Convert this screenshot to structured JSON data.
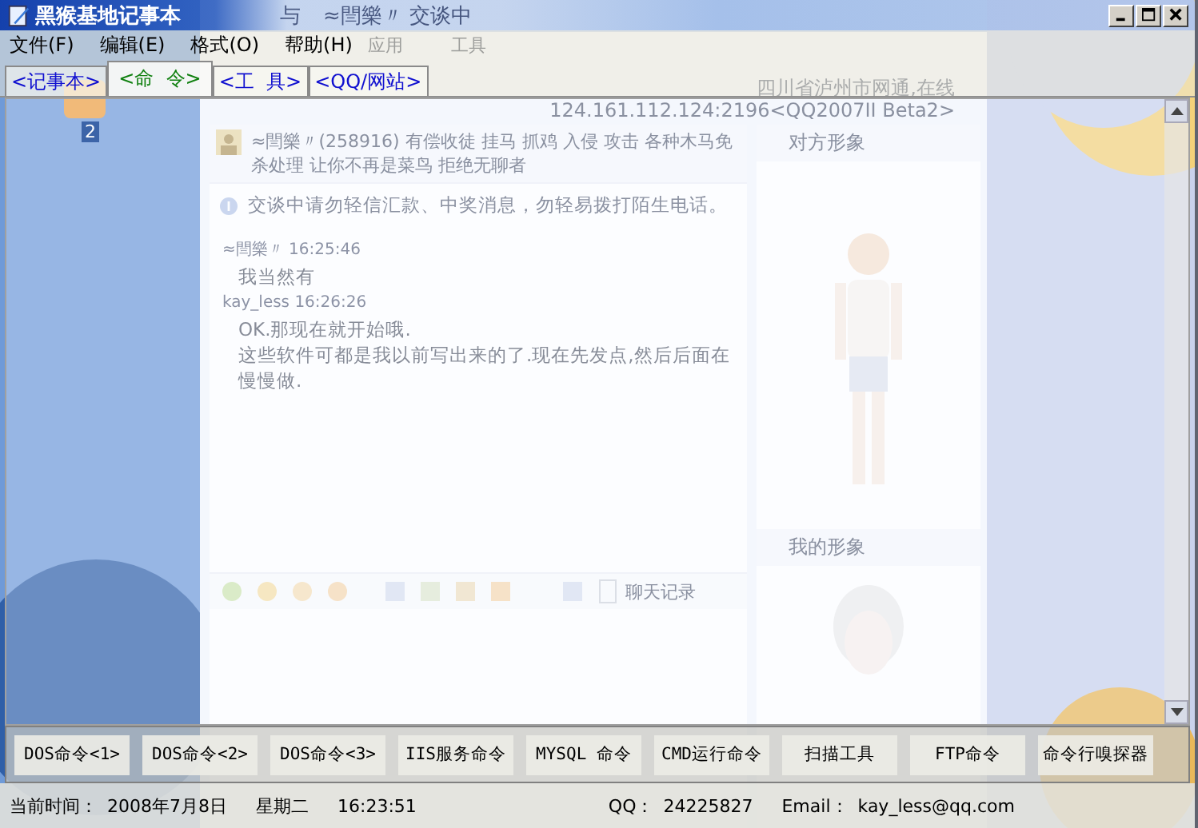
{
  "window": {
    "title": "黑猴基地记事本"
  },
  "menu": [
    {
      "label": "文件(F)"
    },
    {
      "label": "编辑(E)"
    },
    {
      "label": "格式(O)"
    },
    {
      "label": "帮助(H)"
    }
  ],
  "tabs": [
    {
      "label": "<记事本>",
      "selected": false
    },
    {
      "label": "<命  令>",
      "selected": true
    },
    {
      "label": "<工  具>",
      "selected": false
    },
    {
      "label": "<QQ/网站>",
      "selected": false
    }
  ],
  "buttons": [
    "DOS命令<1>",
    "DOS命令<2>",
    "DOS命令<3>",
    "IIS服务命令",
    "MYSQL 命令",
    "CMD运行命令",
    "扫描工具",
    "FTP命令",
    "命令行嗅探器"
  ],
  "status_bar": {
    "time_label": "当前时间：",
    "date": "2008年7月8日",
    "weekday": "星期二",
    "time": "16:23:51",
    "qq_label": "QQ：",
    "qq": "24225827",
    "email_label": "Email：",
    "email": "kay_less@qq.com"
  },
  "desktop": {
    "icon_label": "2"
  },
  "chat_window": {
    "title_prefix": "与",
    "title": "≈閆樂〃 交谈中",
    "menu": [
      "应用",
      "工具"
    ],
    "location": "四川省泸州市网通,在线",
    "address": "124.161.112.124:2196<QQ2007II Beta2>",
    "banner": "≈閆樂〃(258916)  有偿收徒 挂马 抓鸡 入侵 攻击 各种木马免杀处理 让你不再是菜鸟 拒绝无聊者",
    "notice": "交谈中请勿轻信汇款、中奖消息，勿轻易拨打陌生电话。",
    "messages": [
      {
        "sender": "≈閆樂〃",
        "time": "16:25:46",
        "lines": [
          "我当然有"
        ]
      },
      {
        "sender": "kay_less",
        "time": "16:26:26",
        "lines": [
          "OK.那现在就开始哦.",
          "这些软件可都是我以前写出来的了.现在先发点,然后后面在慢慢做."
        ]
      }
    ],
    "history_label": "聊天记录",
    "panels": [
      "对方形象",
      "我的形象"
    ]
  }
}
